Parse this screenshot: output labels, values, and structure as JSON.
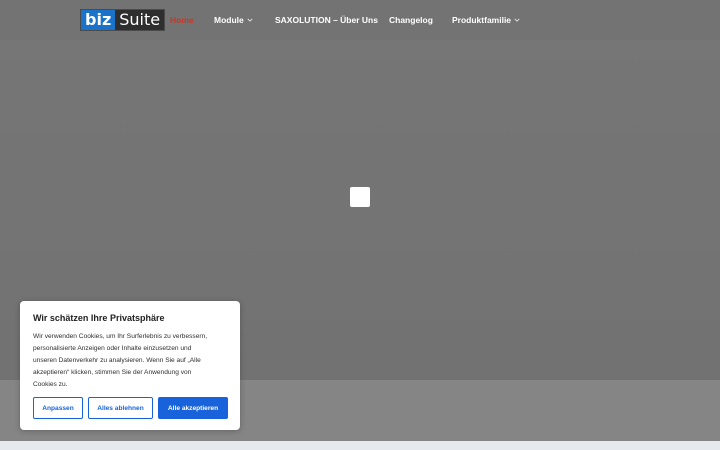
{
  "header": {
    "logo": {
      "part1": "biz",
      "part2": "Suite"
    },
    "nav": [
      {
        "label": "Home",
        "active": true,
        "dropdown": false
      },
      {
        "label": "Module",
        "active": false,
        "dropdown": true
      },
      {
        "label": "SAXOLUTION – Über Uns",
        "active": false,
        "dropdown": false
      },
      {
        "label": "Changelog",
        "active": false,
        "dropdown": false
      },
      {
        "label": "Produktfamilie",
        "active": false,
        "dropdown": true
      }
    ]
  },
  "cookie_banner": {
    "title": "Wir schätzen Ihre Privatsphäre",
    "lines": [
      "Wir verwenden Cookies, um Ihr Surferlebnis zu verbessern,",
      "personalisierte Anzeigen oder Inhalte einzusetzen und",
      "unseren Datenverkehr zu analysieren. Wenn Sie auf „Alle",
      "akzeptieren“ klicken, stimmen Sie der Anwendung von",
      "Cookies zu."
    ],
    "buttons": {
      "customize": "Anpassen",
      "reject_all": "Alles ablehnen",
      "accept_all": "Alle akzeptieren"
    }
  },
  "colors": {
    "accent": "#1863dc",
    "nav_active": "#c0392b",
    "logo_blue": "#1a73c8"
  }
}
